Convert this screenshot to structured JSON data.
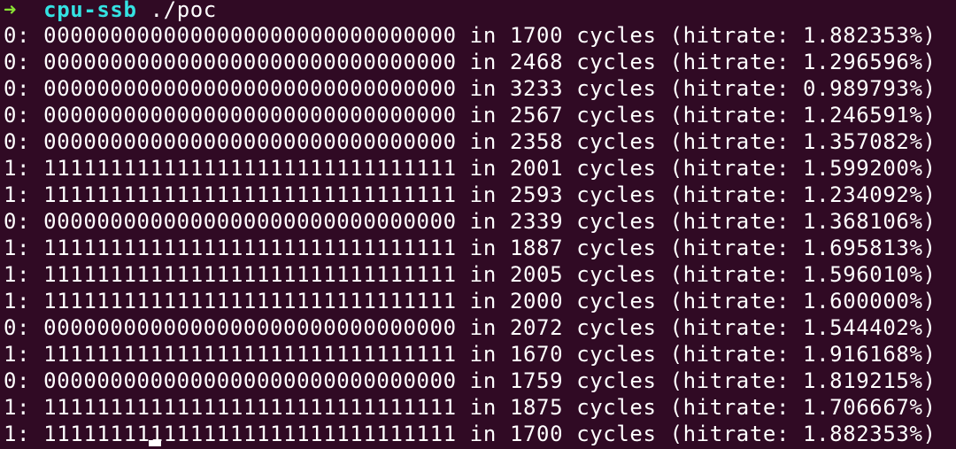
{
  "prompt": {
    "arrow": "➜",
    "directory": "cpu-ssb",
    "command": "./poc"
  },
  "output": [
    {
      "bit": "0:",
      "bits": "0000000000000000000000000000000",
      "in": "in",
      "cycles": "1700",
      "label": "cycles",
      "hitrate": "(hitrate: 1.882353%)"
    },
    {
      "bit": "0:",
      "bits": "0000000000000000000000000000000",
      "in": "in",
      "cycles": "2468",
      "label": "cycles",
      "hitrate": "(hitrate: 1.296596%)"
    },
    {
      "bit": "0:",
      "bits": "0000000000000000000000000000000",
      "in": "in",
      "cycles": "3233",
      "label": "cycles",
      "hitrate": "(hitrate: 0.989793%)"
    },
    {
      "bit": "0:",
      "bits": "0000000000000000000000000000000",
      "in": "in",
      "cycles": "2567",
      "label": "cycles",
      "hitrate": "(hitrate: 1.246591%)"
    },
    {
      "bit": "0:",
      "bits": "0000000000000000000000000000000",
      "in": "in",
      "cycles": "2358",
      "label": "cycles",
      "hitrate": "(hitrate: 1.357082%)"
    },
    {
      "bit": "1:",
      "bits": "1111111111111111111111111111111",
      "in": "in",
      "cycles": "2001",
      "label": "cycles",
      "hitrate": "(hitrate: 1.599200%)"
    },
    {
      "bit": "1:",
      "bits": "1111111111111111111111111111111",
      "in": "in",
      "cycles": "2593",
      "label": "cycles",
      "hitrate": "(hitrate: 1.234092%)"
    },
    {
      "bit": "0:",
      "bits": "0000000000000000000000000000000",
      "in": "in",
      "cycles": "2339",
      "label": "cycles",
      "hitrate": "(hitrate: 1.368106%)"
    },
    {
      "bit": "1:",
      "bits": "1111111111111111111111111111111",
      "in": "in",
      "cycles": "1887",
      "label": "cycles",
      "hitrate": "(hitrate: 1.695813%)"
    },
    {
      "bit": "1:",
      "bits": "1111111111111111111111111111111",
      "in": "in",
      "cycles": "2005",
      "label": "cycles",
      "hitrate": "(hitrate: 1.596010%)"
    },
    {
      "bit": "1:",
      "bits": "1111111111111111111111111111111",
      "in": "in",
      "cycles": "2000",
      "label": "cycles",
      "hitrate": "(hitrate: 1.600000%)"
    },
    {
      "bit": "0:",
      "bits": "0000000000000000000000000000000",
      "in": "in",
      "cycles": "2072",
      "label": "cycles",
      "hitrate": "(hitrate: 1.544402%)"
    },
    {
      "bit": "1:",
      "bits": "1111111111111111111111111111111",
      "in": "in",
      "cycles": "1670",
      "label": "cycles",
      "hitrate": "(hitrate: 1.916168%)"
    },
    {
      "bit": "0:",
      "bits": "0000000000000000000000000000000",
      "in": "in",
      "cycles": "1759",
      "label": "cycles",
      "hitrate": "(hitrate: 1.819215%)"
    },
    {
      "bit": "1:",
      "bits": "1111111111111111111111111111111",
      "in": "in",
      "cycles": "1875",
      "label": "cycles",
      "hitrate": "(hitrate: 1.706667%)"
    },
    {
      "bit": "1:",
      "bits": "1111111111111111111111111111111",
      "in": "in",
      "cycles": "1700",
      "label": "cycles",
      "hitrate": "(hitrate: 1.882353%)"
    }
  ],
  "colors": {
    "background": "#300a24",
    "text": "#ffffff",
    "prompt_arrow": "#8ae234",
    "prompt_directory": "#34e2e2"
  }
}
